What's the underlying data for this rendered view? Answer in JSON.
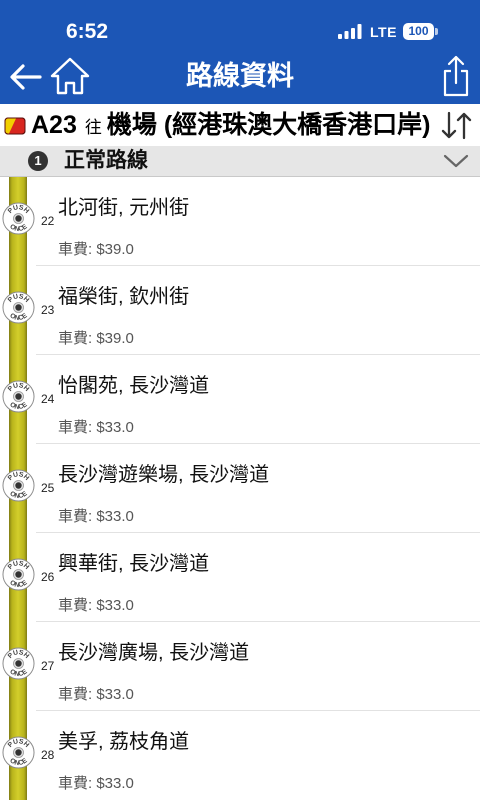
{
  "status_bar": {
    "time": "6:52",
    "network": "LTE",
    "battery": "100",
    "signal_icon": "cellular-signal-icon"
  },
  "nav": {
    "title": "路線資料",
    "back_icon": "back-arrow-icon",
    "home_icon": "home-icon",
    "share_icon": "share-icon"
  },
  "route": {
    "icon": "bus-route-icon",
    "number": "A23",
    "direction_prefix": "往",
    "destination": "機場 (經港珠澳大橋香港口岸)",
    "swap_icon": "swap-direction-icon"
  },
  "section": {
    "index": "1",
    "title": "正常路線",
    "toggle_icon": "chevron-down-icon"
  },
  "stop_icon": {
    "name": "bus-bell-icon",
    "top_text": "PUSH",
    "bottom_text": "ONCE"
  },
  "fare_label": "車費:",
  "stops": [
    {
      "seq": "22",
      "name": "北河街, 元州街",
      "fare": "$39.0"
    },
    {
      "seq": "23",
      "name": "福榮街, 欽州街",
      "fare": "$39.0"
    },
    {
      "seq": "24",
      "name": "怡閣苑, 長沙灣道",
      "fare": "$33.0"
    },
    {
      "seq": "25",
      "name": "長沙灣遊樂場, 長沙灣道",
      "fare": "$33.0"
    },
    {
      "seq": "26",
      "name": "興華街, 長沙灣道",
      "fare": "$33.0"
    },
    {
      "seq": "27",
      "name": "長沙灣廣場, 長沙灣道",
      "fare": "$33.0"
    },
    {
      "seq": "28",
      "name": "美孚, 荔枝角道",
      "fare": "$33.0"
    }
  ],
  "colors": {
    "header_blue": "#1c56b6",
    "section_bg": "#e6e6e6",
    "fare_text": "#555555",
    "route_line": "#d3ce2b",
    "route_line_edge": "#7f7b14"
  }
}
